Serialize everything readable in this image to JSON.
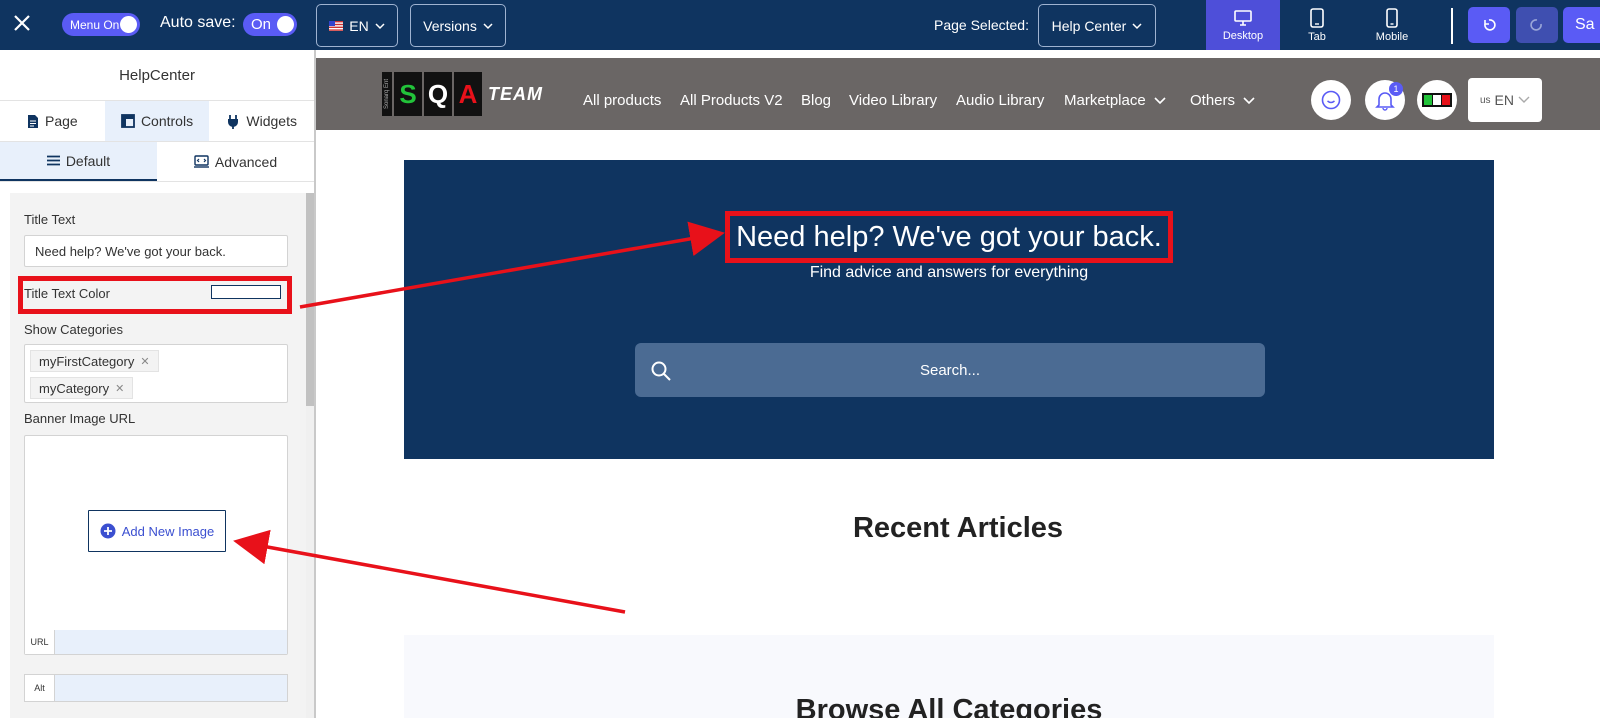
{
  "topbar": {
    "menu_toggle": "Menu On",
    "autosave_label": "Auto save:",
    "autosave_toggle": "On",
    "language": "EN",
    "versions": "Versions",
    "page_selected_label": "Page Selected:",
    "page_selected_value": "Help Center",
    "devices": [
      {
        "label": "Desktop",
        "icon": "desktop-icon",
        "active": true
      },
      {
        "label": "Tab",
        "icon": "tablet-icon",
        "active": false
      },
      {
        "label": "Mobile",
        "icon": "mobile-icon",
        "active": false
      }
    ],
    "save_label": "Sa",
    "accent": "#5a5bf5",
    "bg": "#0f3460"
  },
  "sidebar": {
    "title": "HelpCenter",
    "tabs": [
      {
        "label": "Page",
        "icon": "document-icon",
        "active": false
      },
      {
        "label": "Controls",
        "icon": "controls-icon",
        "active": true
      },
      {
        "label": "Widgets",
        "icon": "plug-icon",
        "active": false
      }
    ],
    "subtabs": [
      {
        "label": "Default",
        "icon": "menu-icon",
        "active": true
      },
      {
        "label": "Advanced",
        "icon": "code-icon",
        "active": false
      }
    ],
    "fields": {
      "title_text_label": "Title Text",
      "title_text_value": "Need help? We've got your back.",
      "title_color_label": "Title Text Color",
      "show_categories_label": "Show Categories",
      "categories": [
        "myFirstCategory",
        "myCategory"
      ],
      "banner_label": "Banner Image URL",
      "add_image": "Add New Image",
      "url_tag": "URL",
      "alt_tag": "Alt"
    }
  },
  "site": {
    "logo": {
      "letters": [
        "S",
        "Q",
        "A"
      ],
      "team": "TEAM",
      "vertical": "Sonarq Ent"
    },
    "nav": [
      "All products",
      "All Products V2",
      "Blog",
      "Video Library",
      "Audio Library",
      "Marketplace",
      "Others"
    ],
    "notification_count": "1",
    "lang": {
      "flag": "us",
      "code": "EN"
    },
    "hero": {
      "title": "Need help? We've got your back.",
      "subtitle": "Find advice and answers for everything",
      "search_placeholder": "Search..."
    },
    "recent_title": "Recent Articles",
    "categories_title": "Browse All Categories"
  },
  "annotation_color": "#e8111a"
}
